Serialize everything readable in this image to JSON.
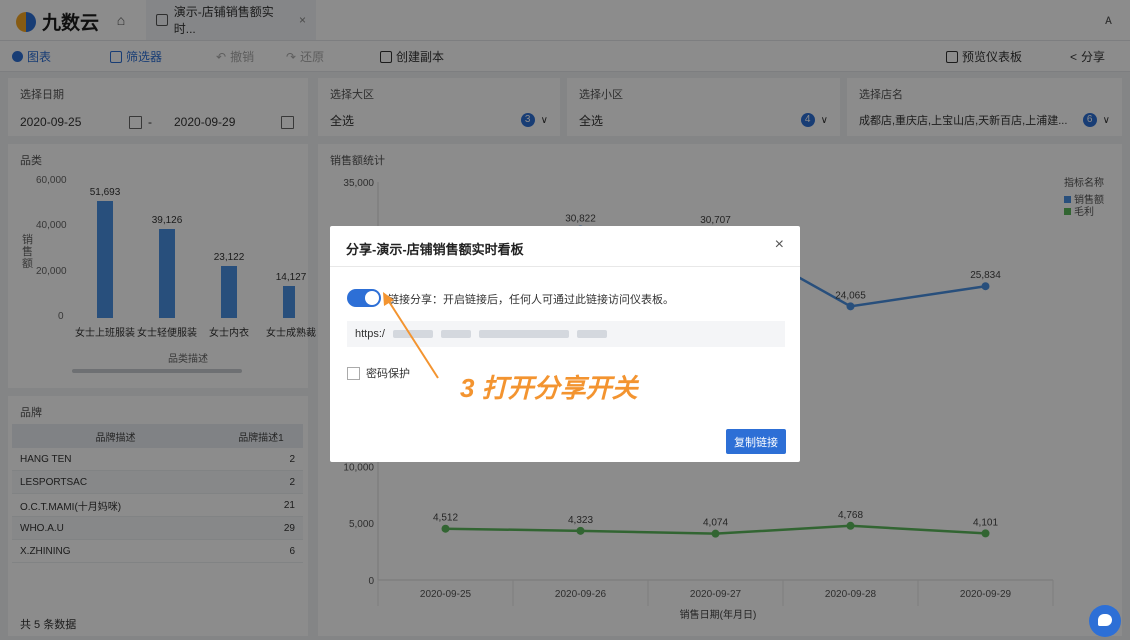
{
  "app": {
    "brand": "九数云"
  },
  "tab": {
    "title": "演示-店铺销售额实时...",
    "close": "×"
  },
  "toolbar": {
    "chart": "图表",
    "filter": "筛选器",
    "undo": "撤销",
    "redo": "还原",
    "copy": "创建副本",
    "preview": "预览仪表板",
    "share": "分享"
  },
  "filters": {
    "date": {
      "label": "选择日期",
      "start": "2020-09-25",
      "sep": "-",
      "end": "2020-09-29"
    },
    "region": {
      "label": "选择大区",
      "value": "全选",
      "count": "3"
    },
    "subregion": {
      "label": "选择小区",
      "value": "全选",
      "count": "4"
    },
    "store": {
      "label": "选择店名",
      "value": "成都店,重庆店,上宝山店,天新百店,上浦建...",
      "count": "6"
    }
  },
  "category_chart": {
    "title": "品类",
    "chart_data": {
      "type": "bar",
      "categories": [
        "女士上班服装",
        "女士轻便服装",
        "女士内衣",
        "女士成熟裁"
      ],
      "values": [
        51693,
        39126,
        23122,
        14127
      ],
      "value_labels": [
        "51,693",
        "39,126",
        "23,122",
        "14,127"
      ],
      "ylabel": "销售额",
      "xlabel": "品类描述",
      "yticks": [
        "60,000",
        "40,000",
        "20,000",
        "0"
      ],
      "ylim": [
        0,
        60000
      ]
    }
  },
  "brand_table": {
    "title": "品牌",
    "columns": [
      "品牌描述",
      "品牌描述1"
    ],
    "rows": [
      [
        "HANG TEN",
        "2"
      ],
      [
        "LESPORTSAC",
        "2"
      ],
      [
        "O.C.T.MAMI(十月妈咪)",
        "21"
      ],
      [
        "WHO.A.U",
        "29"
      ],
      [
        "X.ZHINING",
        "6"
      ]
    ],
    "footer": "共 5 条数据"
  },
  "sales_chart": {
    "title": "销售额统计",
    "chart_data": {
      "type": "line",
      "x": [
        "2020-09-25",
        "2020-09-26",
        "2020-09-27",
        "2020-09-28",
        "2020-09-29"
      ],
      "series": [
        {
          "name": "销售额",
          "values": [
            null,
            30822,
            30707,
            24065,
            25834
          ],
          "labels": [
            "",
            "30,822",
            "30,707",
            "24,065",
            "25,834"
          ]
        },
        {
          "name": "毛利",
          "values": [
            4512,
            4323,
            4074,
            4768,
            4101
          ],
          "labels": [
            "4,512",
            "4,323",
            "4,074",
            "4,768",
            "4,101"
          ]
        }
      ],
      "yticks": [
        "35,000",
        "10,000",
        "5,000",
        "0"
      ],
      "ylim": [
        0,
        35000
      ],
      "xlabel": "销售日期(年月日)",
      "legend_title": "指标名称",
      "colors": [
        "#4a90e2",
        "#5cb85c"
      ]
    }
  },
  "modal": {
    "title": "分享-演示-店铺销售额实时看板",
    "close": "×",
    "toggle_label": "链接分享：开启链接后，任何人可通过此链接访问仪表板。",
    "url_prefix": "https:/",
    "password_label": "密码保护",
    "copy_button": "复制链接"
  },
  "annotation": "3 打开分享开关"
}
